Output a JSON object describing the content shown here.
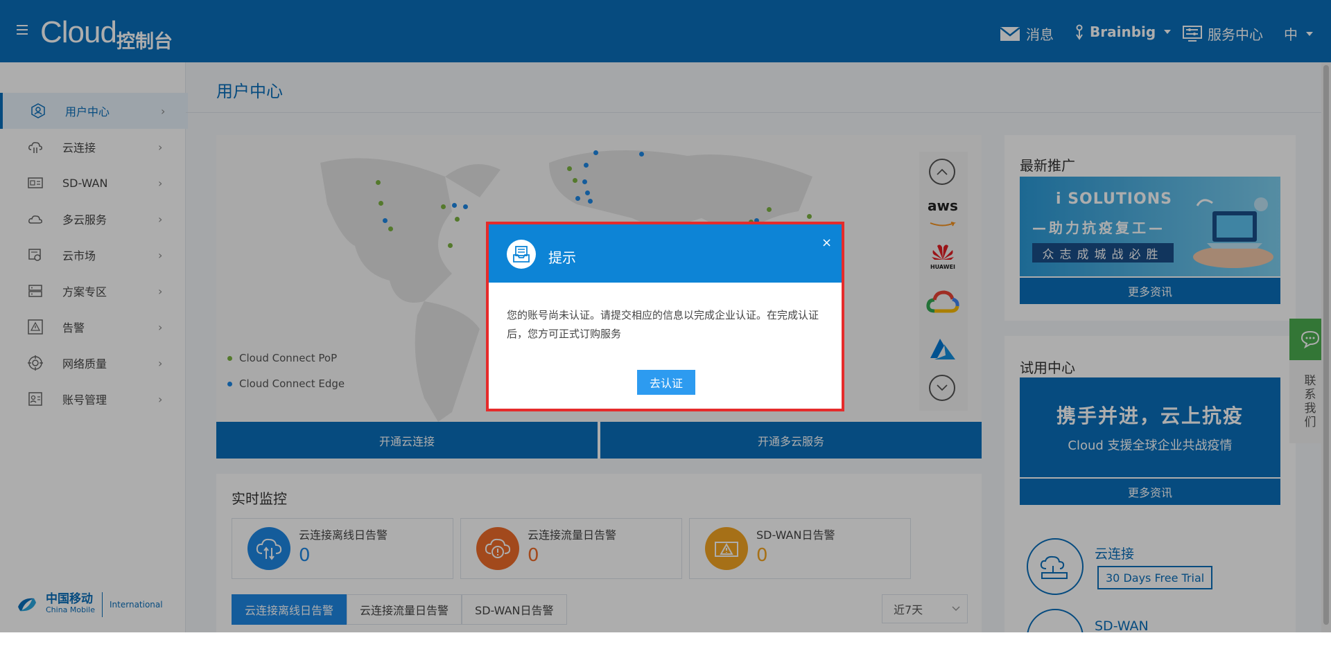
{
  "header": {
    "logo_text": "Cloud",
    "console_label": "控制台",
    "messages_label": "消息",
    "user_label": "Brainbig",
    "service_center_label": "服务中心",
    "language_label": "中"
  },
  "sidebar": {
    "items": [
      {
        "label": "用户中心"
      },
      {
        "label": "云连接"
      },
      {
        "label": "SD-WAN"
      },
      {
        "label": "多云服务"
      },
      {
        "label": "云市场"
      },
      {
        "label": "方案专区"
      },
      {
        "label": "告警"
      },
      {
        "label": "网络质量"
      },
      {
        "label": "账号管理"
      }
    ],
    "brand": {
      "cn": "中国移动",
      "en": "China Mobile",
      "intl": "International"
    }
  },
  "page": {
    "title": "用户中心"
  },
  "map": {
    "legend": [
      {
        "label": "Cloud Connect PoP",
        "color": "#7cb342"
      },
      {
        "label": "Cloud Connect Edge",
        "color": "#1e88e5"
      }
    ],
    "providers": [
      "aws",
      "HUAWEI",
      "Google Cloud",
      "Azure"
    ],
    "buttons": {
      "open_cloud_connect": "开通云连接",
      "open_multicloud": "开通多云服务"
    }
  },
  "monitor": {
    "title": "实时监控",
    "alerts": [
      {
        "name": "云连接离线日告警",
        "count": "0",
        "color": "#1e88e5"
      },
      {
        "name": "云连接流量日告警",
        "count": "0",
        "color": "#ef6c2a"
      },
      {
        "name": "SD-WAN日告警",
        "count": "0",
        "color": "#f5a623"
      }
    ],
    "tabs": [
      "云连接离线日告警",
      "云连接流量日告警",
      "SD-WAN日告警"
    ],
    "range": "近7天"
  },
  "promo": {
    "title": "最新推广",
    "banner_brand": "i SOLUTIONS",
    "banner_line1": "—助力抗疫复工—",
    "banner_line2": "众志成城战必胜",
    "more": "更多资讯"
  },
  "trial": {
    "title": "试用中心",
    "banner_line1": "携手并进，云上抗疫",
    "banner_line2": "Cloud 支援全球企业共战疫情",
    "more": "更多资讯",
    "products": [
      {
        "name": "云连接",
        "badge": "30 Days Free Trial"
      },
      {
        "name": "SD-WAN"
      }
    ]
  },
  "contact": {
    "label": "联系我们"
  },
  "modal": {
    "title": "提示",
    "message": "您的账号尚未认证。请提交相应的信息以完成企业认证。在完成认证后，您方可正式订购服务",
    "button": "去认证",
    "close": "×"
  }
}
